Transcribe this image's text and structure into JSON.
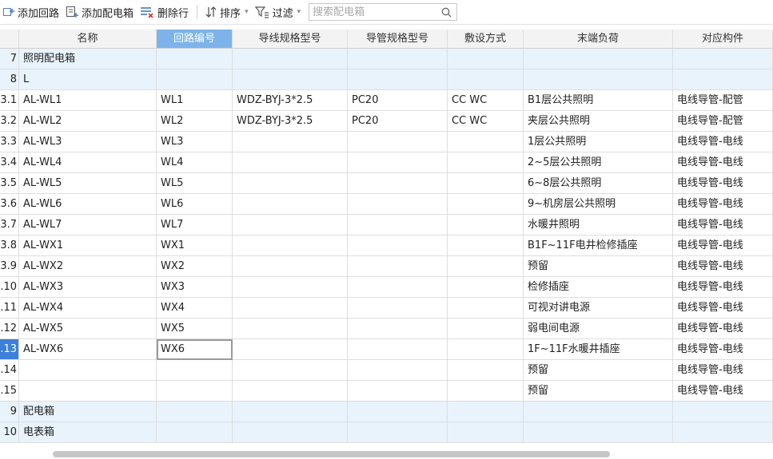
{
  "toolbar": {
    "add_circuit": "添加回路",
    "add_box": "添加配电箱",
    "delete_row": "删除行",
    "sort": "排序",
    "filter": "过滤",
    "search_placeholder": "搜索配电箱"
  },
  "columns": [
    "名称",
    "回路编号",
    "导线规格型号",
    "导管规格型号",
    "敷设方式",
    "末端负荷",
    "对应构件"
  ],
  "active_column": "回路编号",
  "rows": [
    {
      "idx": "7",
      "name": "照明配电箱",
      "circuit": "",
      "wire": "",
      "conduit": "",
      "laying": "",
      "load": "",
      "comp": "",
      "type": "group"
    },
    {
      "idx": "8",
      "name": "L",
      "circuit": "",
      "wire": "",
      "conduit": "",
      "laying": "",
      "load": "",
      "comp": "",
      "type": "group"
    },
    {
      "idx": "3.1",
      "name": "AL-WL1",
      "circuit": "WL1",
      "wire": "WDZ-BYJ-3*2.5",
      "conduit": "PC20",
      "laying": "CC WC",
      "load": "B1层公共照明",
      "comp": "电线导管-配管"
    },
    {
      "idx": "3.2",
      "name": "AL-WL2",
      "circuit": "WL2",
      "wire": "WDZ-BYJ-3*2.5",
      "conduit": "PC20",
      "laying": "CC WC",
      "load": "夹层公共照明",
      "comp": "电线导管-配管"
    },
    {
      "idx": "3.3",
      "name": "AL-WL3",
      "circuit": "WL3",
      "wire": "",
      "conduit": "",
      "laying": "",
      "load": "1层公共照明",
      "comp": "电线导管-电线"
    },
    {
      "idx": "3.4",
      "name": "AL-WL4",
      "circuit": "WL4",
      "wire": "",
      "conduit": "",
      "laying": "",
      "load": "2~5层公共照明",
      "comp": "电线导管-电线"
    },
    {
      "idx": "3.5",
      "name": "AL-WL5",
      "circuit": "WL5",
      "wire": "",
      "conduit": "",
      "laying": "",
      "load": "6~8层公共照明",
      "comp": "电线导管-电线"
    },
    {
      "idx": "3.6",
      "name": "AL-WL6",
      "circuit": "WL6",
      "wire": "",
      "conduit": "",
      "laying": "",
      "load": "9~机房层公共照明",
      "comp": "电线导管-电线"
    },
    {
      "idx": "3.7",
      "name": "AL-WL7",
      "circuit": "WL7",
      "wire": "",
      "conduit": "",
      "laying": "",
      "load": "水暖井照明",
      "comp": "电线导管-电线"
    },
    {
      "idx": "3.8",
      "name": "AL-WX1",
      "circuit": "WX1",
      "wire": "",
      "conduit": "",
      "laying": "",
      "load": "B1F~11F电井检修插座",
      "comp": "电线导管-电线"
    },
    {
      "idx": "3.9",
      "name": "AL-WX2",
      "circuit": "WX2",
      "wire": "",
      "conduit": "",
      "laying": "",
      "load": "预留",
      "comp": "电线导管-电线"
    },
    {
      "idx": ".10",
      "name": "AL-WX3",
      "circuit": "WX3",
      "wire": "",
      "conduit": "",
      "laying": "",
      "load": "检修插座",
      "comp": "电线导管-电线"
    },
    {
      "idx": ".11",
      "name": "AL-WX4",
      "circuit": "WX4",
      "wire": "",
      "conduit": "",
      "laying": "",
      "load": "可视对讲电源",
      "comp": "电线导管-电线"
    },
    {
      "idx": ".12",
      "name": "AL-WX5",
      "circuit": "WX5",
      "wire": "",
      "conduit": "",
      "laying": "",
      "load": "弱电间电源",
      "comp": "电线导管-电线"
    },
    {
      "idx": ".13",
      "name": "AL-WX6",
      "circuit": "WX6",
      "wire": "",
      "conduit": "",
      "laying": "",
      "load": "1F~11F水暖井插座",
      "comp": "电线导管-电线",
      "type": "selected"
    },
    {
      "idx": ".14",
      "name": "",
      "circuit": "",
      "wire": "",
      "conduit": "",
      "laying": "",
      "load": "预留",
      "comp": "电线导管-电线"
    },
    {
      "idx": ".15",
      "name": "",
      "circuit": "",
      "wire": "",
      "conduit": "",
      "laying": "",
      "load": "预留",
      "comp": "电线导管-电线"
    },
    {
      "idx": "9",
      "name": "配电箱",
      "circuit": "",
      "wire": "",
      "conduit": "",
      "laying": "",
      "load": "",
      "comp": "",
      "type": "group"
    },
    {
      "idx": "10",
      "name": "电表箱",
      "circuit": "",
      "wire": "",
      "conduit": "",
      "laying": "",
      "load": "",
      "comp": "",
      "type": "group"
    }
  ]
}
